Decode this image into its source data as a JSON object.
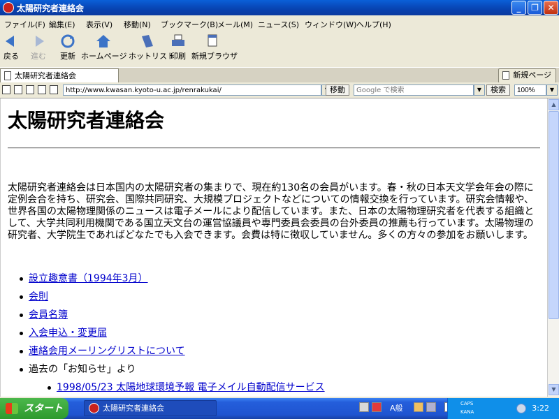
{
  "window": {
    "title": "太陽研究者連絡会",
    "controls": [
      "_",
      "❐",
      "✕"
    ]
  },
  "menubar": {
    "items": [
      "ファイル(F)",
      "編集(E)",
      "表示(V)",
      "移動(N)",
      "ブックマーク(B)",
      "メール(M)",
      "ニュース(S)",
      "ウィンドウ(W)",
      "ヘルプ(H)"
    ]
  },
  "toolbar": {
    "buttons": [
      {
        "label": "戻る",
        "icon": "back-arrow-icon"
      },
      {
        "label": "進む",
        "icon": "forward-arrow-icon"
      },
      {
        "label": "更新",
        "icon": "reload-icon"
      },
      {
        "label": "ホームページ",
        "icon": "home-icon"
      },
      {
        "label": "ホットリスト",
        "icon": "hotlist-icon"
      },
      {
        "label": "印刷",
        "icon": "printer-icon"
      },
      {
        "label": "新規ブラウザ",
        "icon": "new-browser-icon"
      }
    ]
  },
  "tabs": {
    "active_label": "太陽研究者連絡会",
    "new_tab_label": "新規ページ"
  },
  "addressbar": {
    "url": "http://www.kwasan.kyoto-u.ac.jp/renrakukai/",
    "go_label": "移動",
    "search_placeholder": "Google で検索",
    "search_label": "検索",
    "zoom": "100%"
  },
  "page": {
    "heading": "太陽研究者連絡会",
    "intro": "太陽研究者連絡会は日本国内の太陽研究者の集まりで、現在約130名の会員がいます。春・秋の日本天文学会年会の際に定例会合を持ち、研究会、国際共同研究、大規模プロジェクトなどについての情報交換を行っています。研究会情報や、世界各国の太陽物理関係のニュースは電子メールにより配信しています。また、日本の太陽物理研究者を代表する組織として、大学共同利用機関である国立天文台の運営協議員や専門委員会委員の台外委員の推薦も行っています。太陽物理の研究者、大学院生であればどなたでも入会できます。会費は特に徴収していません。多くの方々の参加をお願いします。",
    "links": [
      "設立趣意書（1994年3月）",
      "会則",
      "会員名簿",
      "入会申込・変更届",
      "連絡会用メーリングリストについて"
    ],
    "past_news_label": "過去の「お知らせ」より",
    "news_items": [
      "1998/05/23 太陽地球環境予報 電子メイル自動配信サービス"
    ]
  },
  "taskbar": {
    "start_label": "スタート",
    "task_label": "太陽研究者連絡会",
    "ime_mode": "A般",
    "caps_label": "CAPS",
    "kana_label": "KANA",
    "clock": "3:22"
  },
  "colors": {
    "titlebar": "#0a5fd8",
    "link": "#0000cc",
    "taskbar": "#245edb",
    "start": "#3fa83f"
  }
}
